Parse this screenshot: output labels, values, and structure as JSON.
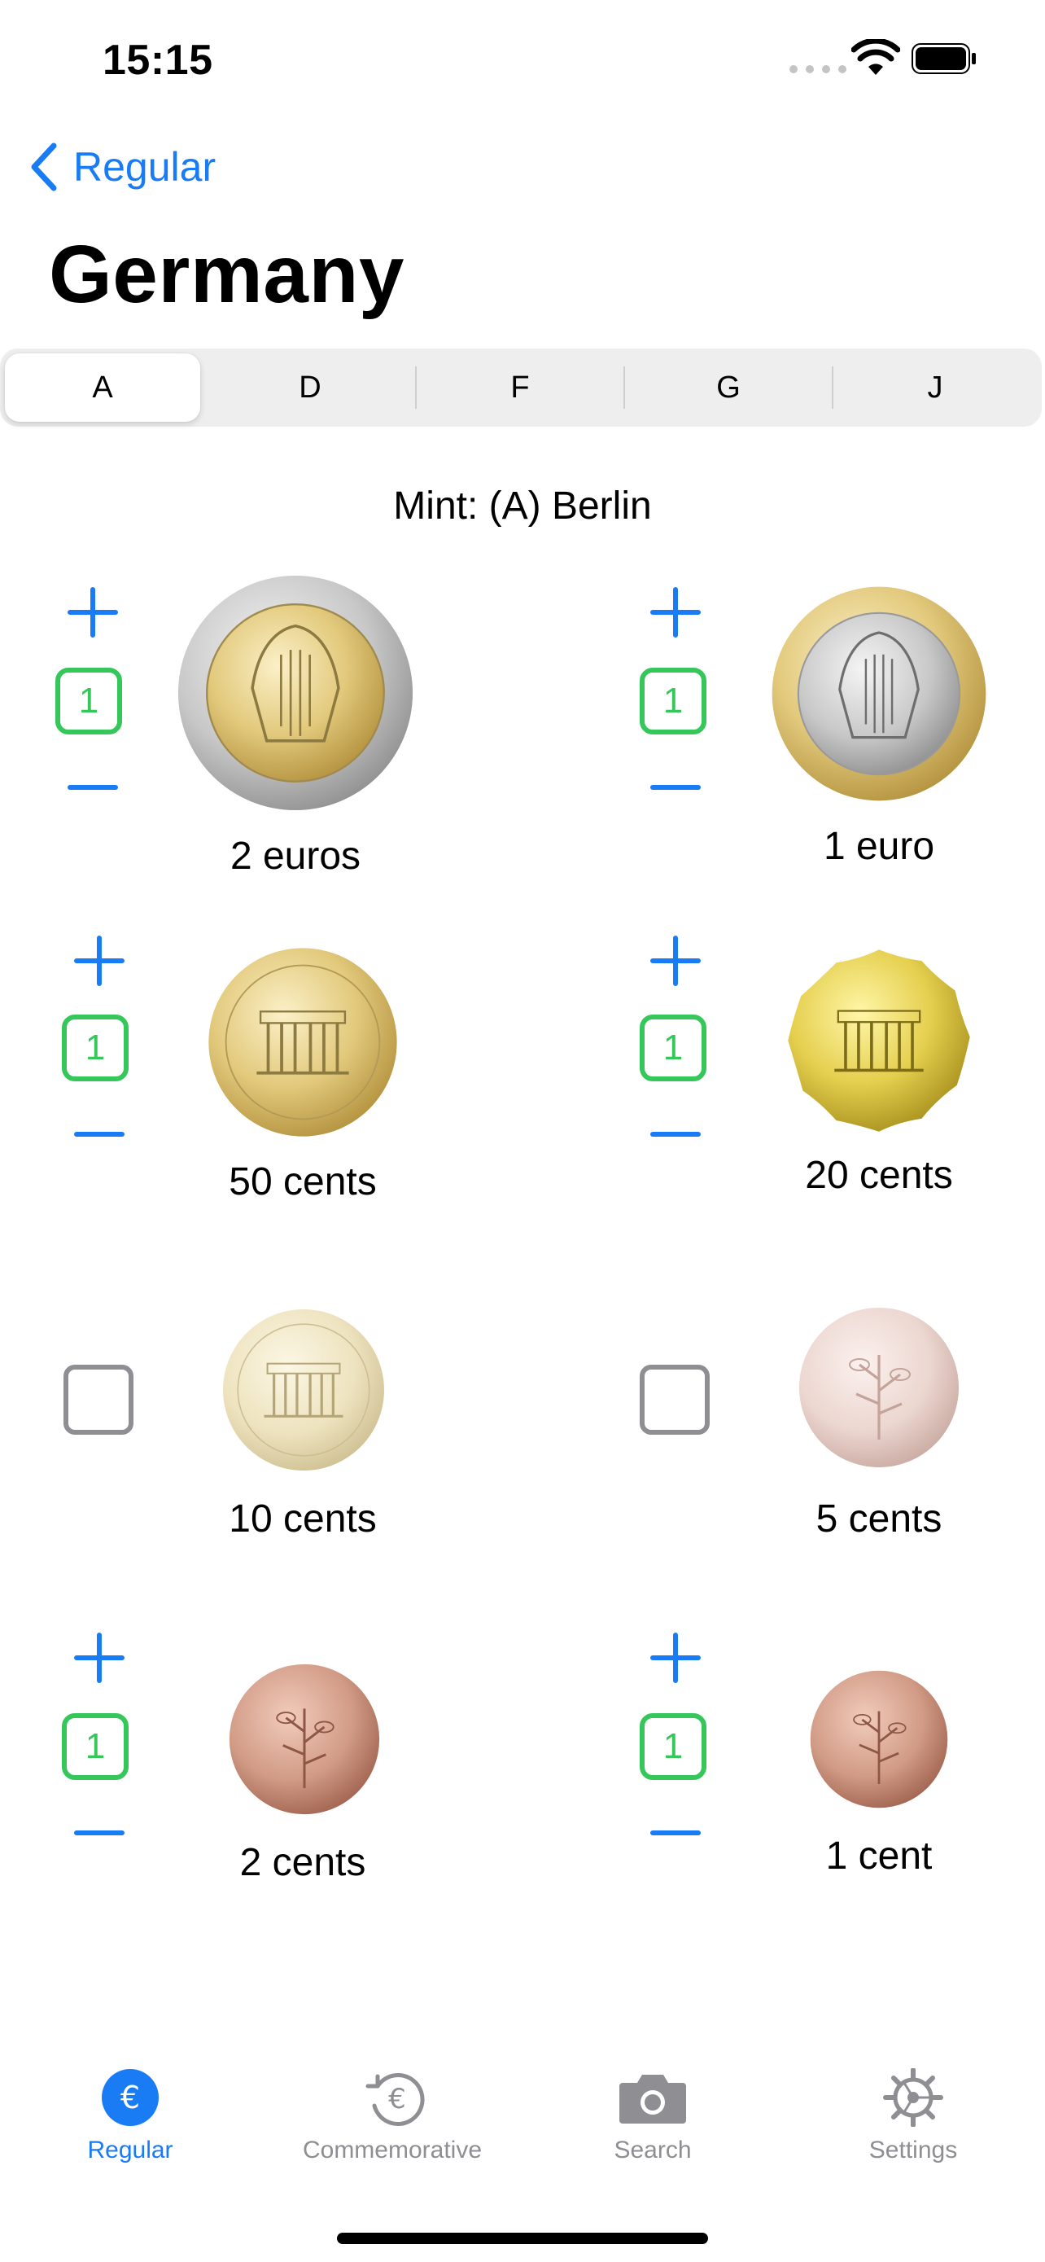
{
  "status_bar": {
    "time": "15:15"
  },
  "nav": {
    "back_label": "Regular",
    "title": "Germany"
  },
  "segments": [
    "A",
    "D",
    "F",
    "G",
    "J"
  ],
  "mint_label": "Mint: (A) Berlin",
  "coins": [
    {
      "label": "2 euros",
      "count": "1",
      "collected": true
    },
    {
      "label": "1 euro",
      "count": "1",
      "collected": true
    },
    {
      "label": "50 cents",
      "count": "1",
      "collected": true
    },
    {
      "label": "20 cents",
      "count": "1",
      "collected": true
    },
    {
      "label": "10 cents",
      "count": "",
      "collected": false
    },
    {
      "label": "5 cents",
      "count": "",
      "collected": false
    },
    {
      "label": "2 cents",
      "count": "1",
      "collected": true
    },
    {
      "label": "1 cent",
      "count": "1",
      "collected": true
    }
  ],
  "tabs": [
    {
      "label": "Regular",
      "icon": "euro-circle-icon",
      "active": true
    },
    {
      "label": "Commemorative",
      "icon": "euro-history-icon",
      "active": false
    },
    {
      "label": "Search",
      "icon": "camera-icon",
      "active": false
    },
    {
      "label": "Settings",
      "icon": "gear-icon",
      "active": false
    }
  ],
  "colors": {
    "accent": "#1a7cf5",
    "count_green": "#35c759",
    "inactive_gray": "#8e8e93"
  }
}
